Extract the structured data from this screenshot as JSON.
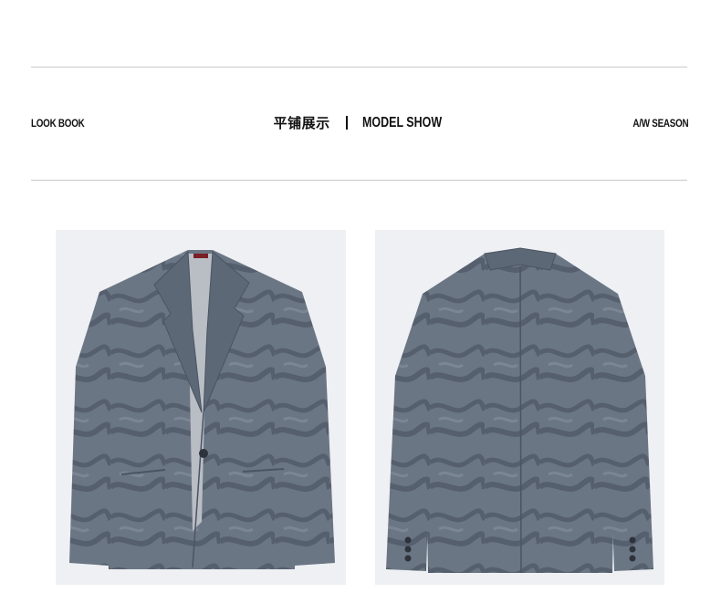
{
  "header": {
    "left_label": "LOOK BOOK",
    "center_cn": "平铺展示",
    "center_en": "MODEL SHOW",
    "right_label": "A/W SEASON"
  },
  "images": {
    "front": {
      "alt": "blazer-front-flat-lay"
    },
    "back": {
      "alt": "blazer-back-flat-lay"
    }
  },
  "colors": {
    "fabric": "#6b7685",
    "fabric_dark": "#525c6b",
    "lining": "#b9bdc4",
    "photo_bg": "#eef0f3",
    "rule": "#c9c9c9",
    "collar_label": "#7a1f26"
  }
}
